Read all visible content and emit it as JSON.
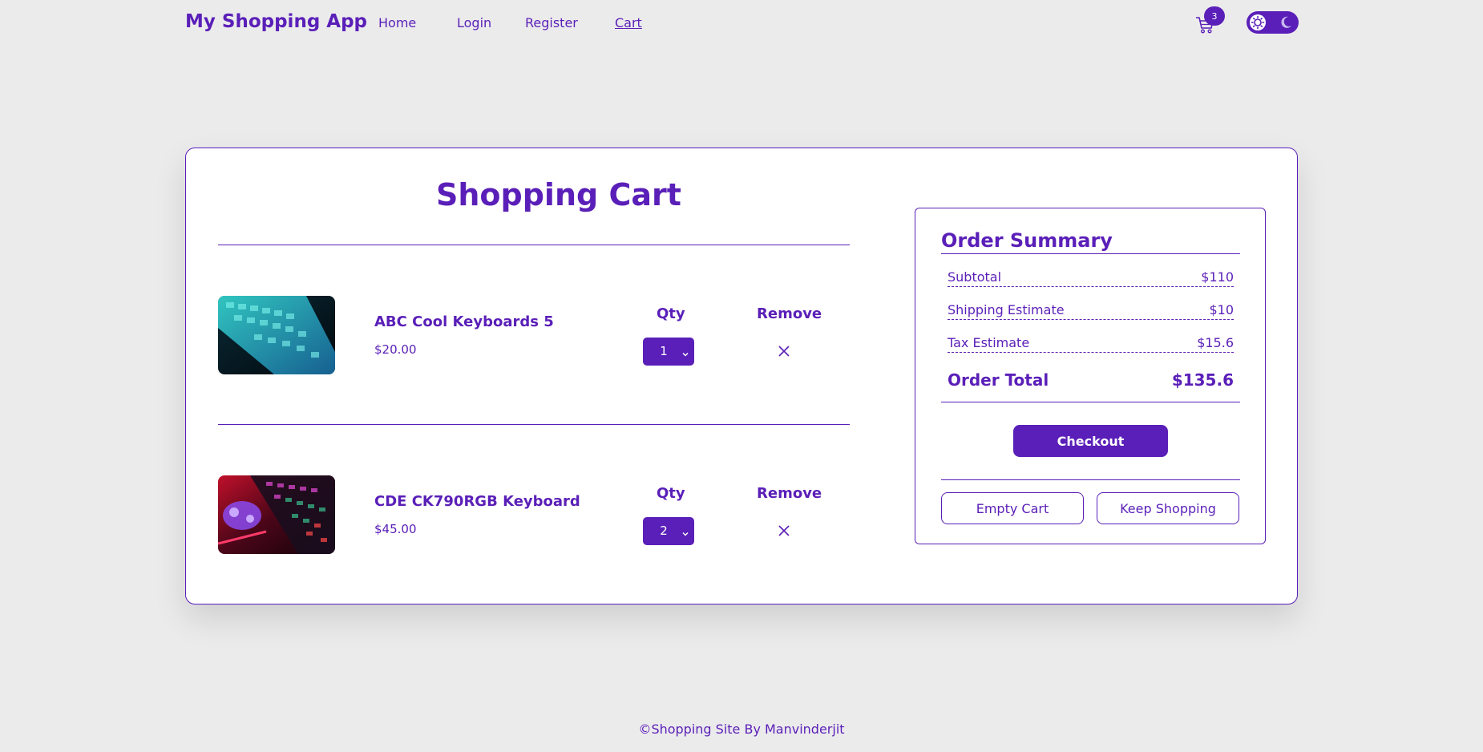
{
  "nav": {
    "brand": "My Shopping App",
    "links": [
      "Home",
      "Login",
      "Register",
      "Cart"
    ],
    "cart_count": "3"
  },
  "cart": {
    "title": "Shopping Cart",
    "qty_label": "Qty",
    "remove_label": "Remove",
    "items": [
      {
        "name": "ABC Cool Keyboards 5",
        "price": "$20.00",
        "qty": "1"
      },
      {
        "name": "CDE CK790RGB Keyboard",
        "price": "$45.00",
        "qty": "2"
      }
    ]
  },
  "summary": {
    "title": "Order Summary",
    "rows": [
      {
        "label": "Subtotal",
        "value": "$110"
      },
      {
        "label": "Shipping Estimate",
        "value": "$10"
      },
      {
        "label": "Tax Estimate",
        "value": "$15.6"
      }
    ],
    "total_label": "Order Total",
    "total_value": "$135.6",
    "checkout_label": "Checkout",
    "empty_label": "Empty Cart",
    "keep_label": "Keep Shopping"
  },
  "footer": {
    "text": "©Shopping Site By Manvinderjit"
  },
  "colors": {
    "accent": "#5a1fb8",
    "background": "#ebebec",
    "card": "#ffffff"
  },
  "icons": [
    "cart-icon",
    "sun-icon",
    "moon-icon",
    "close-icon",
    "chevron-down-icon"
  ]
}
